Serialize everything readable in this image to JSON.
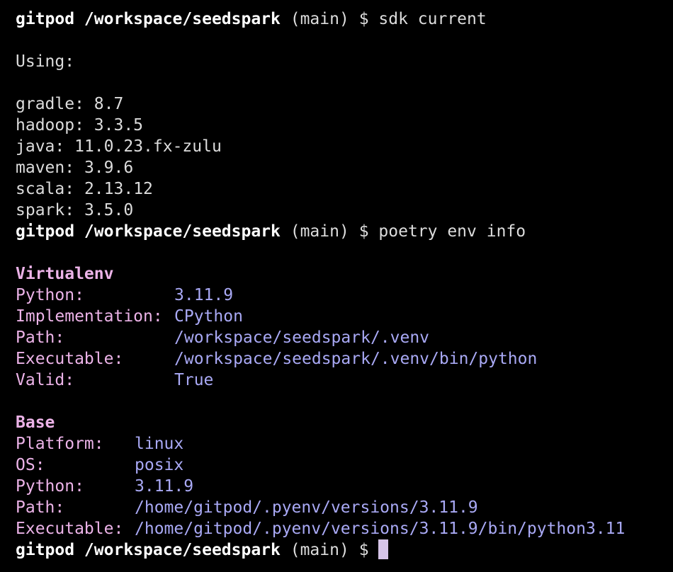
{
  "prompt": {
    "user_path": "gitpod /workspace/seedspark",
    "branch": "(main)",
    "symbol": "$"
  },
  "commands": {
    "first": "sdk current",
    "second": "poetry env info"
  },
  "sdk_output": {
    "using_label": "Using:",
    "items": [
      {
        "name": "gradle:",
        "version": "8.7"
      },
      {
        "name": "hadoop:",
        "version": "3.3.5"
      },
      {
        "name": "java:",
        "version": "11.0.23.fx-zulu"
      },
      {
        "name": "maven:",
        "version": "3.9.6"
      },
      {
        "name": "scala:",
        "version": "2.13.12"
      },
      {
        "name": "spark:",
        "version": "3.5.0"
      }
    ]
  },
  "virtualenv": {
    "heading": "Virtualenv",
    "rows": [
      {
        "key": "Python:",
        "value": "3.11.9"
      },
      {
        "key": "Implementation:",
        "value": "CPython"
      },
      {
        "key": "Path:",
        "value": "/workspace/seedspark/.venv"
      },
      {
        "key": "Executable:",
        "value": "/workspace/seedspark/.venv/bin/python"
      },
      {
        "key": "Valid:",
        "value": "True"
      }
    ]
  },
  "base": {
    "heading": "Base",
    "rows": [
      {
        "key": "Platform:",
        "value": "linux"
      },
      {
        "key": "OS:",
        "value": "posix"
      },
      {
        "key": "Python:",
        "value": "3.11.9"
      },
      {
        "key": "Path:",
        "value": "/home/gitpod/.pyenv/versions/3.11.9"
      },
      {
        "key": "Executable:",
        "value": "/home/gitpod/.pyenv/versions/3.11.9/bin/python3.11"
      }
    ]
  },
  "colors": {
    "background": "#000000",
    "text": "#dcdcdc",
    "key": "#ecb3e8",
    "value": "#a9a9f5",
    "cursor": "#d6c4e8"
  }
}
